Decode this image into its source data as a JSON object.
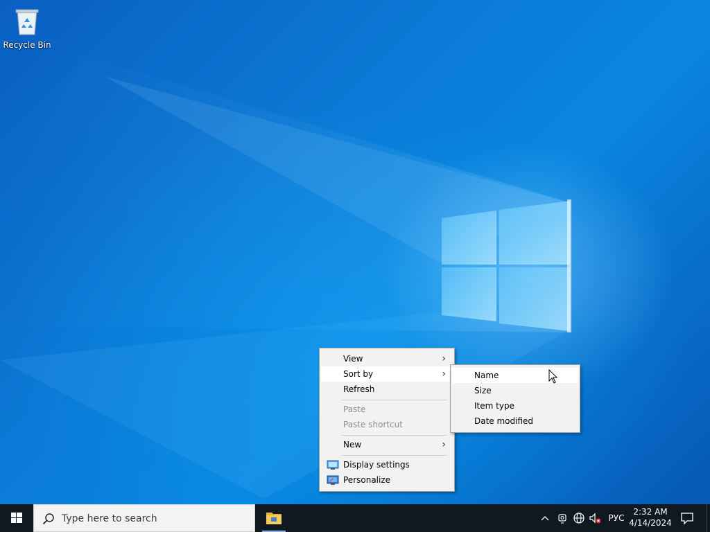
{
  "desktop": {
    "icons": [
      {
        "label": "Recycle Bin",
        "icon": "recycle-bin-icon"
      }
    ],
    "accent_color": "#0b78d4"
  },
  "context_menu": {
    "items": {
      "view": {
        "label": "View",
        "has_submenu": true
      },
      "sort_by": {
        "label": "Sort by",
        "has_submenu": true,
        "highlighted": true
      },
      "refresh": {
        "label": "Refresh"
      },
      "paste": {
        "label": "Paste",
        "disabled": true
      },
      "paste_shortcut": {
        "label": "Paste shortcut",
        "disabled": true
      },
      "new": {
        "label": "New",
        "has_submenu": true
      },
      "display_settings": {
        "label": "Display settings",
        "icon": "display-settings-icon"
      },
      "personalize": {
        "label": "Personalize",
        "icon": "personalize-icon"
      }
    }
  },
  "sort_submenu": {
    "items": {
      "name": {
        "label": "Name",
        "highlighted": true
      },
      "size": {
        "label": "Size"
      },
      "item_type": {
        "label": "Item type"
      },
      "date_modified": {
        "label": "Date modified"
      }
    }
  },
  "taskbar": {
    "search": {
      "placeholder": "Type here to search"
    },
    "pinned_apps": [
      {
        "icon": "file-explorer-icon"
      }
    ],
    "tray": {
      "icons": [
        "chevron-up-icon",
        "meet-now-icon",
        "network-icon",
        "volume-muted-icon"
      ],
      "language": "РУС",
      "time": "2:32 AM",
      "date": "4/14/2024"
    },
    "background_color": "#101820"
  }
}
